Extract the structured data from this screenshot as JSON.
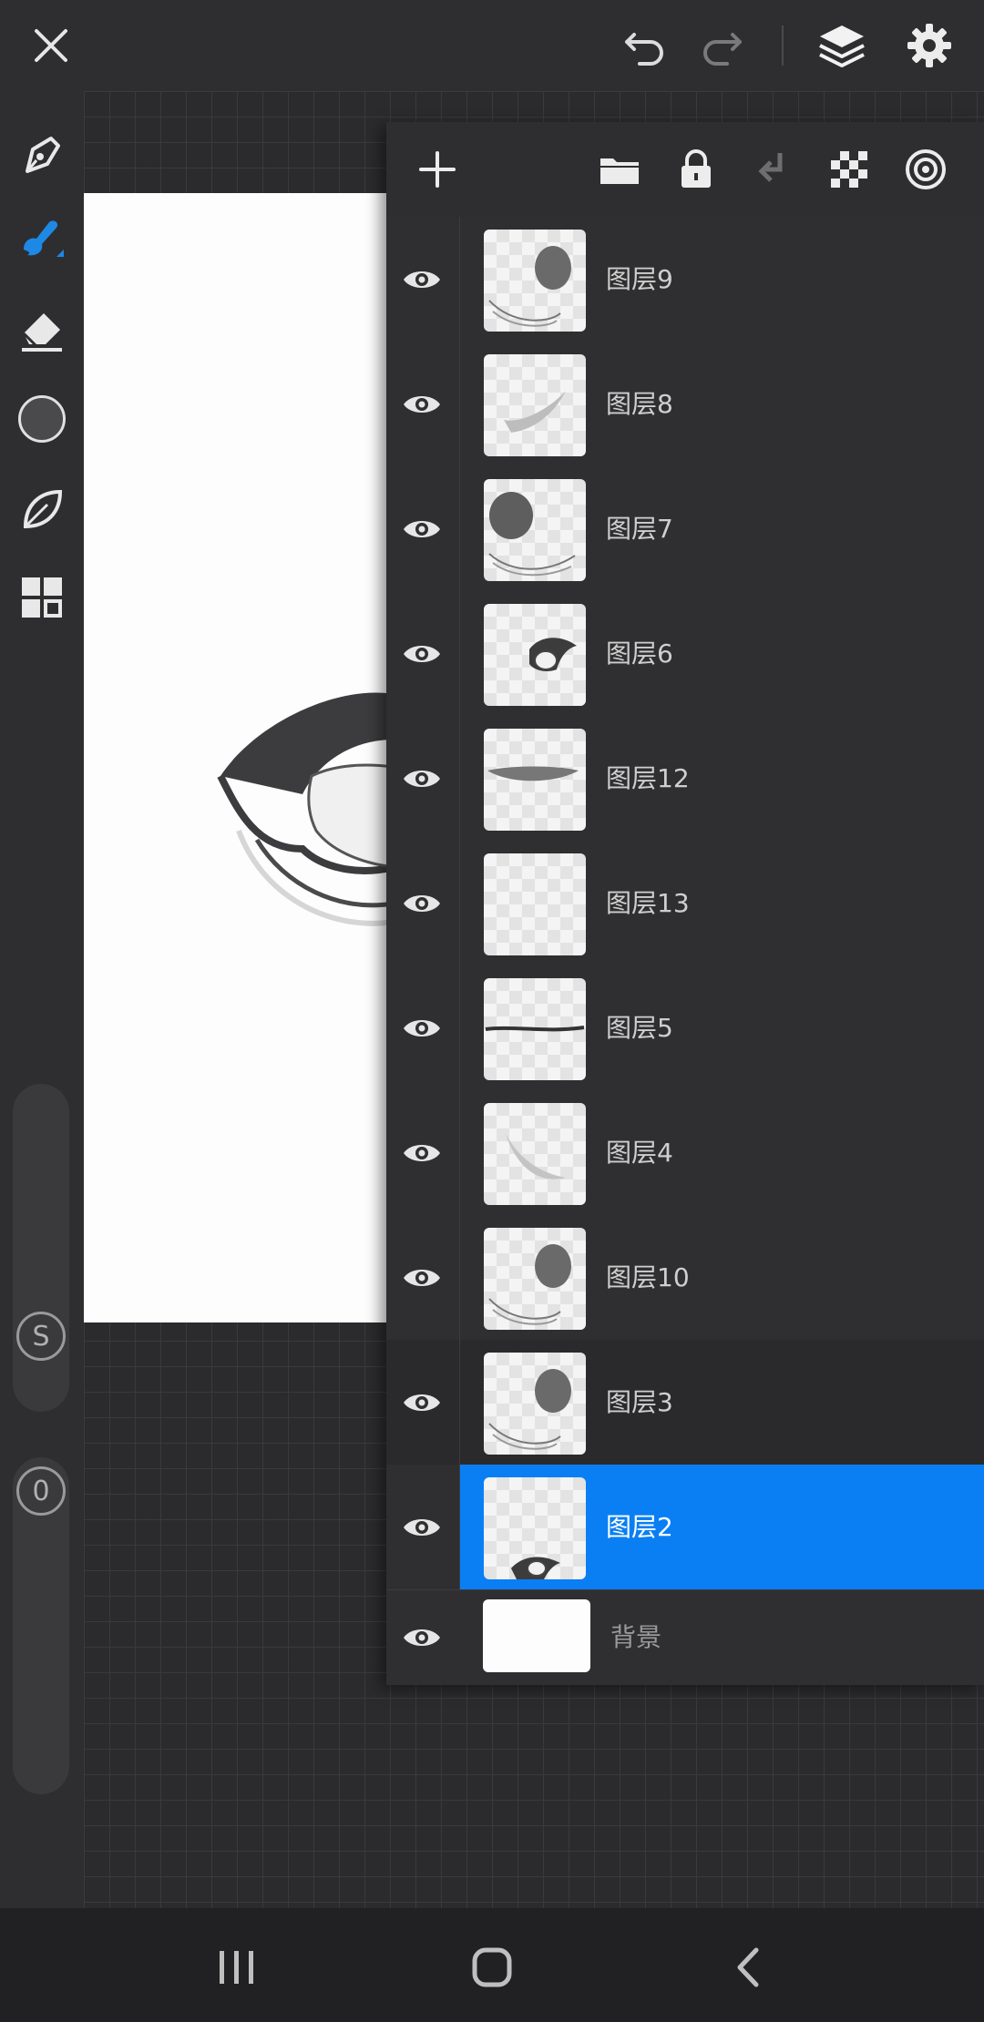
{
  "topbar": {
    "close_icon": "close-icon",
    "undo_icon": "undo-icon",
    "redo_icon": "redo-icon",
    "layers_icon": "layers-icon",
    "settings_icon": "gear-icon"
  },
  "left_tools": {
    "items": [
      "pen-tool-icon",
      "brush-tool-icon",
      "eraser-tool-icon",
      "color-swatch",
      "leaf-tool-icon",
      "grid-tool-icon"
    ],
    "active_color": "#4a4a4c",
    "accent": "#1e88e5",
    "size_slider_label": "S",
    "opacity_slider_label": "0"
  },
  "layers_toolbar": {
    "add_icon": "plus-icon",
    "folder_icon": "folder-icon",
    "lock_icon": "lock-icon",
    "merge_down_icon": "merge-down-icon",
    "transparency_icon": "checkerboard-icon",
    "target_icon": "target-icon"
  },
  "layers": [
    {
      "name": "图层9",
      "selected": false
    },
    {
      "name": "图层8",
      "selected": false
    },
    {
      "name": "图层7",
      "selected": false
    },
    {
      "name": "图层6",
      "selected": false
    },
    {
      "name": "图层12",
      "selected": false
    },
    {
      "name": "图层13",
      "selected": false
    },
    {
      "name": "图层5",
      "selected": false
    },
    {
      "name": "图层4",
      "selected": false
    },
    {
      "name": "图层10",
      "selected": false
    },
    {
      "name": "图层3",
      "selected": false
    },
    {
      "name": "图层2",
      "selected": true
    }
  ],
  "background_layer": {
    "name": "背景"
  },
  "nav": {
    "recents_icon": "recents-icon",
    "home_icon": "home-icon",
    "back_icon": "back-icon"
  }
}
